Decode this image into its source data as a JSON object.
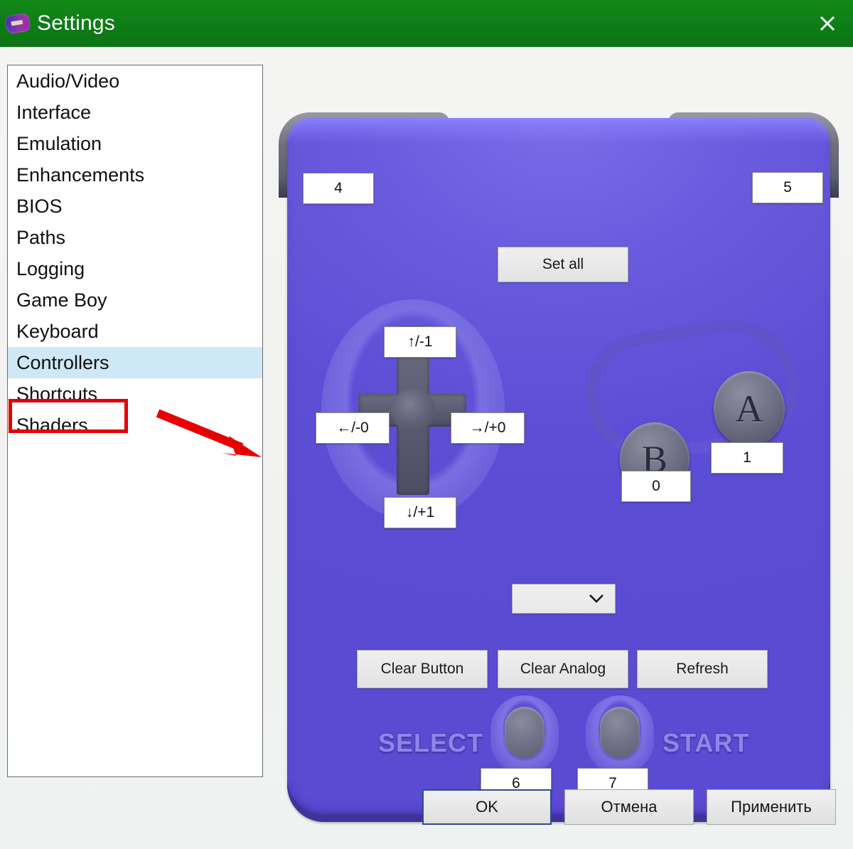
{
  "window": {
    "title": "Settings",
    "icon": "gamepad-icon",
    "close_label": "✕",
    "titlebar_color": "#0e7d16"
  },
  "sidebar": {
    "items": [
      {
        "label": "Audio/Video",
        "selected": false
      },
      {
        "label": "Interface",
        "selected": false
      },
      {
        "label": "Emulation",
        "selected": false
      },
      {
        "label": "Enhancements",
        "selected": false
      },
      {
        "label": "BIOS",
        "selected": false
      },
      {
        "label": "Paths",
        "selected": false
      },
      {
        "label": "Logging",
        "selected": false
      },
      {
        "label": "Game Boy",
        "selected": false
      },
      {
        "label": "Keyboard",
        "selected": false
      },
      {
        "label": "Controllers",
        "selected": true
      },
      {
        "label": "Shortcuts",
        "selected": false
      },
      {
        "label": "Shaders",
        "selected": false
      }
    ],
    "selection_color": "#cfe8f7"
  },
  "annotation": {
    "highlight_color": "#e60000",
    "target": "Controllers"
  },
  "controller": {
    "body_color": "#5b4ad2",
    "set_all_label": "Set all",
    "shoulder_left_value": "4",
    "shoulder_right_value": "5",
    "dpad": {
      "up": "↑/-1",
      "left": "←/-0",
      "right": "→/+0",
      "down": "↓/+1"
    },
    "face_buttons": {
      "a_glyph": "A",
      "a_value": "1",
      "b_glyph": "B",
      "b_value": "0"
    },
    "select": {
      "label": "SELECT",
      "value": "6"
    },
    "start": {
      "label": "START",
      "value": "7"
    },
    "device_combo": {
      "value": "",
      "placeholder": ""
    },
    "actions": {
      "clear_button": "Clear Button",
      "clear_analog": "Clear Analog",
      "refresh": "Refresh"
    }
  },
  "footer": {
    "ok": "OK",
    "cancel": "Отмена",
    "apply": "Применить"
  }
}
